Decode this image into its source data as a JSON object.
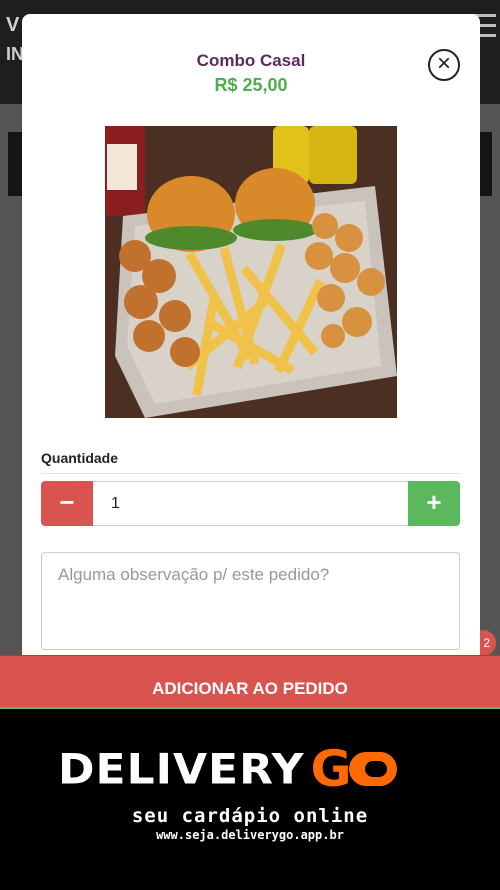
{
  "background": {
    "header_line1": "V",
    "header_line2": "IN"
  },
  "modal": {
    "title": "Combo Casal",
    "price": "R$ 25,00",
    "close_icon": "×",
    "image_alt": "Combo Casal",
    "quantity_label": "Quantidade",
    "quantity_value": "1",
    "minus_icon": "−",
    "plus_icon": "+",
    "notes_placeholder": "Alguma observação p/ este pedido?",
    "add_button": "ADICIONAR AO PEDIDO"
  },
  "cart_badge": "2",
  "footer": {
    "brand_word": "DELIVERY",
    "brand_go": "G",
    "tagline": "seu cardápio online",
    "website": "www.seja.deliverygo.app.br"
  },
  "colors": {
    "title": "#5b2b5f",
    "price": "#4cae4c",
    "minus": "#d9534f",
    "plus": "#5cb85c",
    "add_button": "#d9534f",
    "brand_orange": "#ff6a00"
  }
}
